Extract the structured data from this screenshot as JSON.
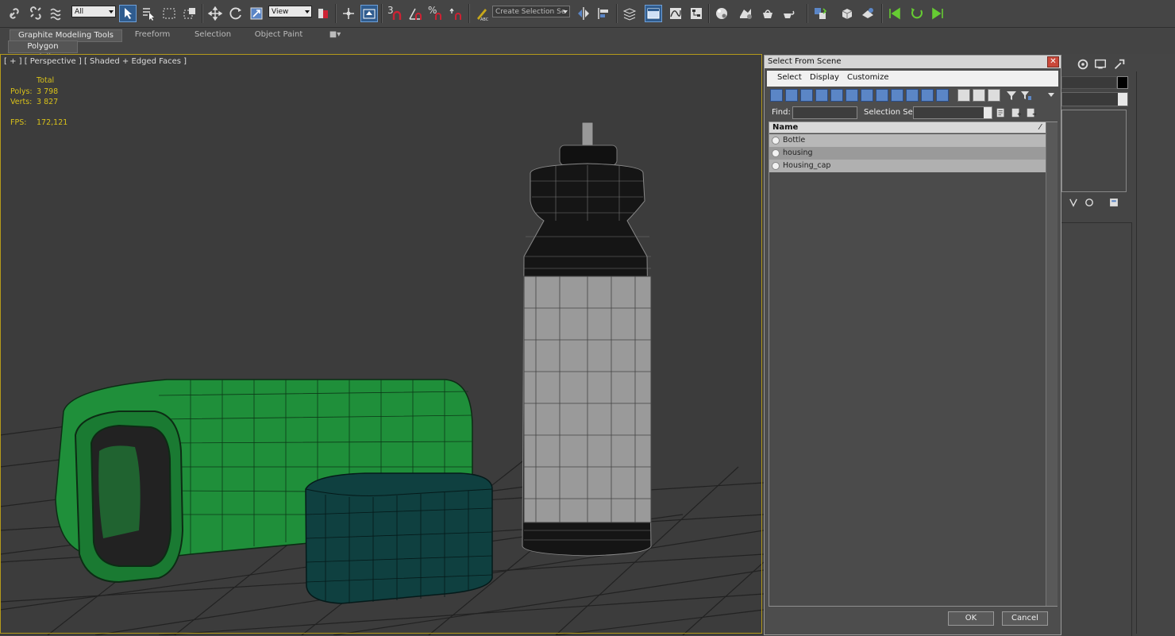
{
  "toolbar": {
    "selection_filter": "All",
    "ref_coord": "View",
    "snap_label": "3",
    "angle_snap_label": "%",
    "named_selection_placeholder": "Create Selection Se"
  },
  "ribbon": {
    "tabs": [
      "Graphite Modeling Tools",
      "Freeform",
      "Selection",
      "Object Paint"
    ],
    "sub_label": "Polygon Modeling"
  },
  "viewport": {
    "label": "[ + ] [ Perspective ] [ Shaded + Edged Faces ]",
    "stats": {
      "total_header": "Total",
      "polys_label": "Polys:",
      "polys_value": "3 798",
      "verts_label": "Verts:",
      "verts_value": "3 827",
      "fps_label": "FPS:",
      "fps_value": "172,121"
    }
  },
  "dialog": {
    "title": "Select From Scene",
    "menu": [
      "Select",
      "Display",
      "Customize"
    ],
    "find_label": "Find:",
    "selection_set_label": "Selection Set:",
    "column_name": "Name",
    "objects": [
      "Bottle",
      "housing",
      "Housing_cap"
    ],
    "ok_label": "OK",
    "cancel_label": "Cancel"
  },
  "colors": {
    "viewport_border": "#b59a1a",
    "housing_green": "#1f8f3a",
    "cap_teal": "#0f4040",
    "bottle_label": "#9a9a9a"
  }
}
